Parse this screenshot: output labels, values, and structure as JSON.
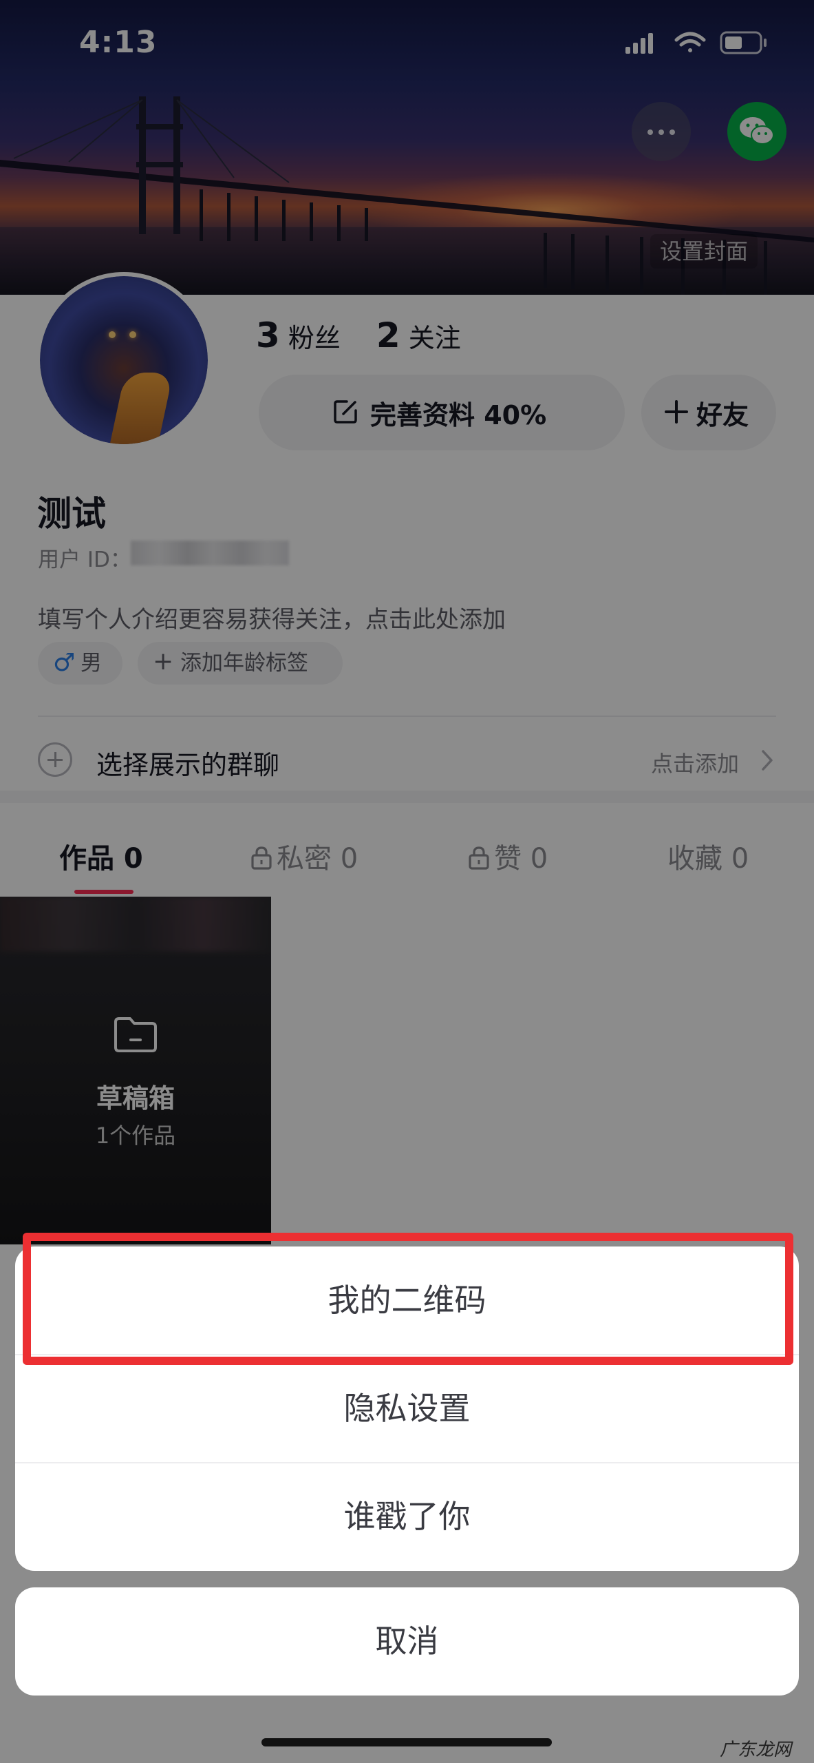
{
  "status_bar": {
    "time": "4:13",
    "icons": [
      "cellular-signal-icon",
      "wifi-icon",
      "battery-icon"
    ]
  },
  "cover": {
    "more_icon": "more-dots-icon",
    "share_icon": "wechat-icon",
    "set_cover_label": "设置封面"
  },
  "profile": {
    "followers_count": "3",
    "followers_label": "粉丝",
    "following_count": "2",
    "following_label": "关注",
    "edit_profile_label": "完善资料 40%",
    "add_friend_label": "好友",
    "name": "测试",
    "user_id_label": "用户 ID：",
    "bio_placeholder": "填写个人介绍更容易获得关注，点击此处添加",
    "gender_label": "男",
    "gender_color": "#2a7fe6",
    "age_tag_label": "添加年龄标签",
    "group_chat_label": "选择展示的群聊",
    "group_chat_action": "点击添加"
  },
  "tabs": [
    {
      "label": "作品 0",
      "active": true,
      "locked": false
    },
    {
      "label": "私密 0",
      "active": false,
      "locked": true
    },
    {
      "label": "赞 0",
      "active": false,
      "locked": true
    },
    {
      "label": "收藏 0",
      "active": false,
      "locked": false
    }
  ],
  "accent_color": "#fe2c55",
  "draft": {
    "title": "草稿箱",
    "count_label": "1个作品"
  },
  "action_sheet": {
    "items": [
      {
        "label": "我的二维码",
        "highlighted": true
      },
      {
        "label": "隐私设置"
      },
      {
        "label": "谁戳了你"
      }
    ],
    "cancel_label": "取消",
    "highlight_color": "#ec2f32"
  },
  "watermark": "广东龙网"
}
